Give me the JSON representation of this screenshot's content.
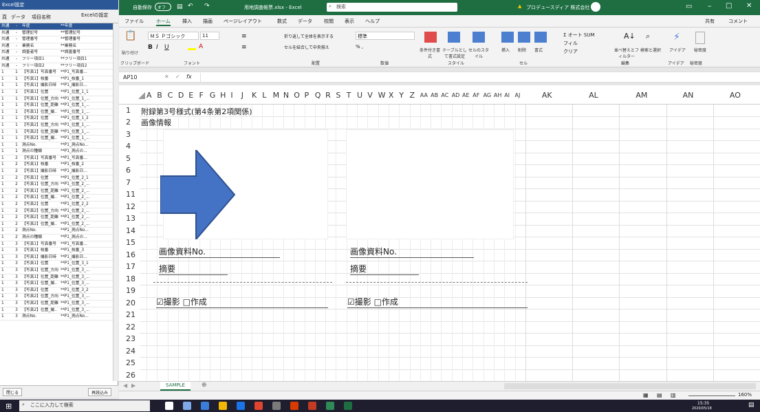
{
  "left_panel": {
    "title": "Excel設定",
    "headers": [
      "頁",
      "データ",
      "項目名称",
      "Excelの設定"
    ],
    "rows": [
      [
        "共通",
        "-",
        "年度",
        "**年度"
      ],
      [
        "共通",
        "-",
        "管理記号",
        "**管理記号"
      ],
      [
        "共通",
        "-",
        "管理番号",
        "**管理番号"
      ],
      [
        "共通",
        "-",
        "業務名",
        "**業務名"
      ],
      [
        "共通",
        "-",
        "調査者号",
        "**調査番号"
      ],
      [
        "共通",
        "-",
        "フリー項目1",
        "**フリー項目1"
      ],
      [
        "共通",
        "-",
        "フリー項目2",
        "**フリー項目2"
      ],
      [
        "1",
        "1",
        "【写真1】写真番号",
        "**P1_写真番..."
      ],
      [
        "1",
        "1",
        "【写真1】枝番",
        "**P1_枝番_1"
      ],
      [
        "1",
        "1",
        "【写真1】撮影日時",
        "**P1_撮影日..."
      ],
      [
        "1",
        "1",
        "【写真1】位置",
        "**P1_位置_1_1"
      ],
      [
        "1",
        "1",
        "【写真1】位置_方向",
        "**P1_位置_1_..."
      ],
      [
        "1",
        "1",
        "【写真1】位置_距離",
        "**P1_位置_1_..."
      ],
      [
        "1",
        "1",
        "【写真1】位置_撮..",
        "**P1_位置_1_..."
      ],
      [
        "1",
        "1",
        "【写真2】位置",
        "**P1_位置_1_2"
      ],
      [
        "1",
        "1",
        "【写真2】位置_方向",
        "**P1_位置_1_..."
      ],
      [
        "1",
        "1",
        "【写真2】位置_距離",
        "**P1_位置_1_..."
      ],
      [
        "1",
        "1",
        "【写真2】位置_撮..",
        "**P1_位置_1_..."
      ],
      [
        "1",
        "1",
        "測点No.",
        "**P1_測点No..."
      ],
      [
        "1",
        "1",
        "測点の種類",
        "**P1_測点の..."
      ],
      [
        "1",
        "2",
        "【写真1】写真番号",
        "**P1_写真番..."
      ],
      [
        "1",
        "2",
        "【写真1】枝番",
        "**P1_枝番_2"
      ],
      [
        "1",
        "2",
        "【写真1】撮影日時",
        "**P1_撮影日..."
      ],
      [
        "1",
        "2",
        "【写真1】位置",
        "**P1_位置_2_1"
      ],
      [
        "1",
        "2",
        "【写真1】位置_方向",
        "**P1_位置_2_..."
      ],
      [
        "1",
        "2",
        "【写真1】位置_距離",
        "**P1_位置_2_..."
      ],
      [
        "1",
        "2",
        "【写真1】位置_撮..",
        "**P1_位置_2_..."
      ],
      [
        "1",
        "2",
        "【写真2】位置",
        "**P1_位置_2_2"
      ],
      [
        "1",
        "2",
        "【写真2】位置_方向",
        "**P1_位置_2_..."
      ],
      [
        "1",
        "2",
        "【写真2】位置_距離",
        "**P1_位置_2_..."
      ],
      [
        "1",
        "2",
        "【写真2】位置_撮..",
        "**P1_位置_2_..."
      ],
      [
        "1",
        "2",
        "測点No.",
        "**P1_測点No..."
      ],
      [
        "1",
        "2",
        "測点の種類",
        "**P1_測点の..."
      ],
      [
        "1",
        "3",
        "【写真1】写真番号",
        "**P1_写真番..."
      ],
      [
        "1",
        "3",
        "【写真1】枝番",
        "**P1_枝番_3"
      ],
      [
        "1",
        "3",
        "【写真1】撮影日時",
        "**P1_撮影日..."
      ],
      [
        "1",
        "3",
        "【写真1】位置",
        "**P1_位置_3_1"
      ],
      [
        "1",
        "3",
        "【写真1】位置_方向",
        "**P1_位置_3_..."
      ],
      [
        "1",
        "3",
        "【写真1】位置_距離",
        "**P1_位置_3_..."
      ],
      [
        "1",
        "3",
        "【写真1】位置_撮..",
        "**P1_位置_3_..."
      ],
      [
        "1",
        "3",
        "【写真2】位置",
        "**P1_位置_3_2"
      ],
      [
        "1",
        "3",
        "【写真2】位置_方向",
        "**P1_位置_3_..."
      ],
      [
        "1",
        "3",
        "【写真2】位置_距離",
        "**P1_位置_3_..."
      ],
      [
        "1",
        "3",
        "【写真2】位置_撮..",
        "**P1_位置_3_..."
      ],
      [
        "1",
        "3",
        "測点No.",
        "**P1_測点No..."
      ]
    ],
    "close_label": "閉じる",
    "reload_label": "再読込み"
  },
  "titlebar": {
    "autosave": "自動保存",
    "autosave_state": "オフ",
    "filename": "用地調査帳票.xlsx - Excel",
    "search": "検索",
    "warning_user": "プロデュースディア 株式会社"
  },
  "ribbon_tabs": [
    "ファイル",
    "ホーム",
    "挿入",
    "描画",
    "ページレイアウト",
    "数式",
    "データ",
    "校閲",
    "表示",
    "ヘルプ"
  ],
  "ribbon_right": {
    "share": "共有",
    "comment": "コメント"
  },
  "ribbon": {
    "paste": "貼り付け",
    "clipboard": "クリップボード",
    "font_name": "ＭＳ Ｐゴシック",
    "font_size": "11",
    "font_group": "フォント",
    "wrap": "折り返して全体を表示する",
    "merge": "セルを結合して中央揃え",
    "align_group": "配置",
    "numfmt": "標準",
    "num_group": "数値",
    "cond": "条件付き書式",
    "table": "テーブルとして書式設定",
    "cellstyle": "セルのスタイル",
    "style_group": "スタイル",
    "insert": "挿入",
    "delete": "削除",
    "format": "書式",
    "cell_group": "セル",
    "autosum": "オート SUM",
    "fill": "フィル",
    "clear": "クリア",
    "sort": "並べ替えとフィルター",
    "find": "検索と選択",
    "edit_group": "編集",
    "ideas": "アイデア",
    "sensitivity": "秘密度",
    "ideas_group": "アイデア",
    "sens_group": "秘密度"
  },
  "formula": {
    "cellref": "AP10",
    "fx": "fx"
  },
  "columns_small": [
    "A",
    "B",
    "C",
    "D",
    "E",
    "F",
    "G",
    "H",
    "I",
    "J",
    "K",
    "L",
    "M",
    "N",
    "O",
    "P",
    "Q",
    "R",
    "S",
    "T",
    "U",
    "V",
    "W",
    "X",
    "Y",
    "Z",
    "AA",
    "AB",
    "AC",
    "AD",
    "AE",
    "AF",
    "AG",
    "AH",
    "AI",
    "AJ"
  ],
  "columns_large": [
    "AK",
    "AL",
    "AM",
    "AN",
    "AO"
  ],
  "rows": [
    "1",
    "2",
    "3",
    "4",
    "5",
    "6",
    "7",
    "11",
    "12",
    "13",
    "14",
    "15",
    "16",
    "17",
    "18",
    "19",
    "20",
    "21",
    "22",
    "23",
    "24",
    "25",
    "26"
  ],
  "sheet": {
    "r1": "附録第3号様式(第4条第2項関係)",
    "r2": "画像情報",
    "img_no": "画像資料No.",
    "summary": "摘要",
    "check1": "☑撮影",
    "check2": "□作成"
  },
  "sheettab": "SAMPLE",
  "zoom": "160%",
  "taskbar": {
    "search": "ここに入力して検索",
    "time": "15:35",
    "date": "2020/05/18"
  }
}
